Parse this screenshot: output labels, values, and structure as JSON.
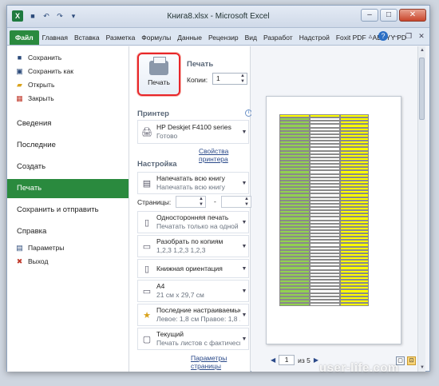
{
  "window": {
    "title": "Книга8.xlsx - Microsoft Excel",
    "app_icon": "X"
  },
  "ribbon": {
    "tabs": [
      "Файл",
      "Главная",
      "Вставка",
      "Разметка",
      "Формулы",
      "Данные",
      "Рецензир",
      "Вид",
      "Разработ",
      "Надстрой",
      "Foxit PDF",
      "ABBYY PD"
    ]
  },
  "nav": {
    "save": "Сохранить",
    "save_as": "Сохранить как",
    "open": "Открыть",
    "close": "Закрыть",
    "info": "Сведения",
    "recent": "Последние",
    "new": "Создать",
    "print": "Печать",
    "save_send": "Сохранить и отправить",
    "help": "Справка",
    "options": "Параметры",
    "exit": "Выход"
  },
  "print_panel": {
    "print_button": "Печать",
    "section_print": "Печать",
    "copies_label": "Копии:",
    "copies_value": "1",
    "section_printer": "Принтер",
    "printer_name": "HP Deskjet F4100 series",
    "printer_status": "Готово",
    "printer_props": "Свойства принтера",
    "section_settings": "Настройка",
    "scope_title": "Напечатать всю книгу",
    "scope_sub": "Напечатать всю книгу",
    "pages_label": "Страницы:",
    "pages_sep": "-",
    "sides_title": "Односторонняя печать",
    "sides_sub": "Печатать только на одной с...",
    "collate_title": "Разобрать по копиям",
    "collate_sub": "1,2,3    1,2,3    1,2,3",
    "orientation": "Книжная ориентация",
    "paper_title": "A4",
    "paper_sub": "21 см x 29,7 см",
    "margins_title": "Последние настраиваемые ...",
    "margins_sub": "Левое: 1,8 см    Правое: 1,8 ...",
    "scale_title": "Текущий",
    "scale_sub": "Печать листов с фактическ...",
    "page_setup": "Параметры страницы"
  },
  "preview": {
    "page_current": "1",
    "page_total": "из 5"
  },
  "colors": {
    "file_tab": "#2a8a3e",
    "highlight": "#e8262a"
  },
  "watermark": "user-life.com"
}
